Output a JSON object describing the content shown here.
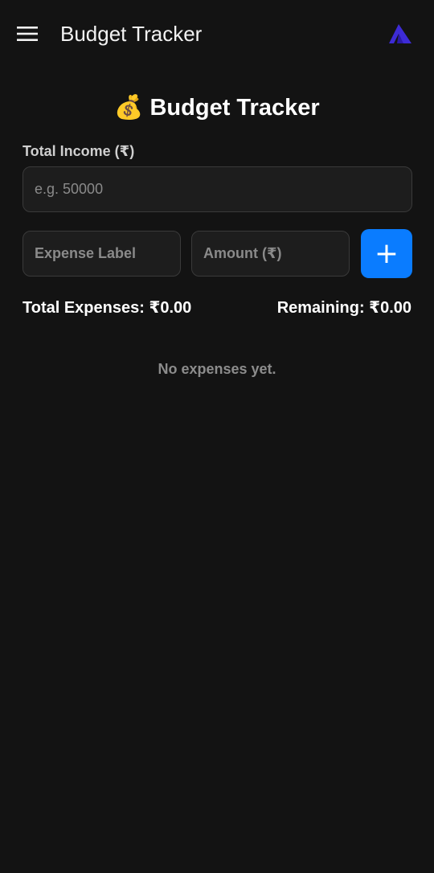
{
  "appbar": {
    "title": "Budget Tracker",
    "menu_icon": "hamburger-menu-icon",
    "logo_icon": "brand-logo-icon"
  },
  "main": {
    "heading_emoji": "💰",
    "heading": "Budget Tracker",
    "income": {
      "label": "Total Income (₹)",
      "placeholder": "e.g. 50000",
      "value": ""
    },
    "expense_form": {
      "label_placeholder": "Expense Label",
      "amount_placeholder": "Amount (₹)",
      "add_button": "+"
    },
    "summary": {
      "total_expenses": "Total Expenses: ₹0.00",
      "remaining": "Remaining: ₹0.00"
    },
    "empty_message": "No expenses yet."
  },
  "colors": {
    "background": "#131313",
    "accent": "#0a7cff",
    "field_bg": "#1d1d1d",
    "muted_text": "#8c8c8c",
    "logo": "#3d2bd6"
  }
}
